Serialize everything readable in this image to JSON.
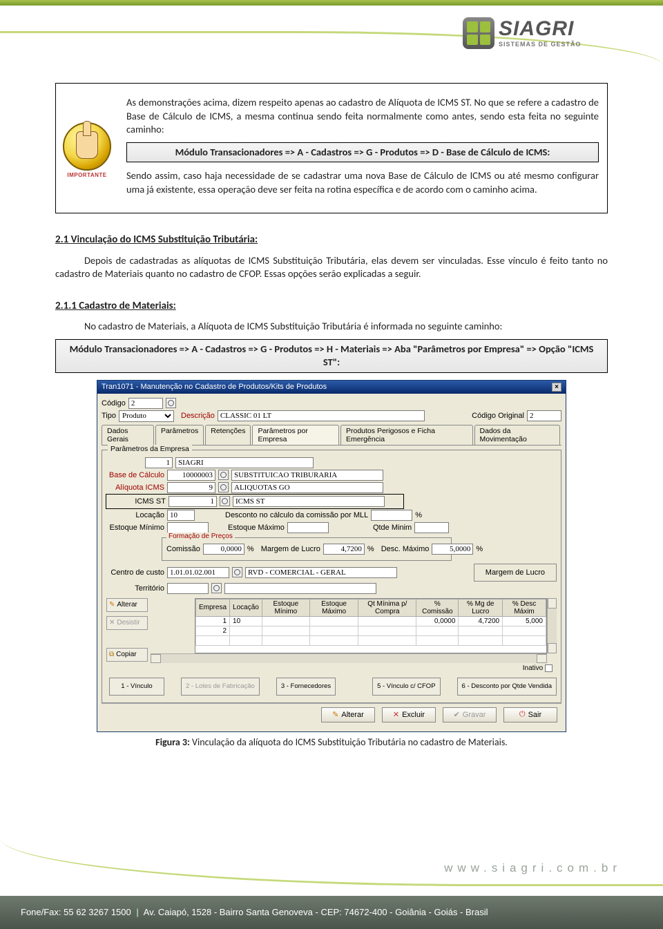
{
  "logo": {
    "name": "SIAGRI",
    "tagline": "SISTEMAS DE GESTÃO"
  },
  "callout": {
    "p1": "As demonstrações acima, dizem respeito apenas ao cadastro de Alíquota de ICMS ST. No que se refere a cadastro de Base de Cálculo de ICMS, a mesma continua sendo feita normalmente como antes, sendo esta feita no seguinte caminho:",
    "path": "Módulo Transacionadores => A - Cadastros => G - Produtos => D - Base de Cálculo de ICMS:",
    "p2": "Sendo assim, caso haja necessidade de se cadastrar uma nova Base de Cálculo de ICMS ou até mesmo configurar uma já existente, essa operação deve ser feita na rotina específica e de acordo com o caminho acima.",
    "badge": "IMPORTANTE"
  },
  "sec21": {
    "title": "2.1  Vinculação do ICMS Substituição Tributária:",
    "p": "Depois de cadastradas as alíquotas de ICMS Substituição Tributária, elas devem ser vinculadas. Esse vínculo é feito tanto no cadastro de Materiais quanto no cadastro de CFOP. Essas opções serão explicadas a seguir."
  },
  "sec211": {
    "title": "2.1.1  Cadastro de Materiais:",
    "p": "No cadastro de Materiais, a Alíquota de ICMS Substituição Tributária é informada no seguinte caminho:",
    "path": "Módulo Transacionadores => A - Cadastros => G - Produtos => H - Materiais => Aba \"Parâmetros por Empresa\" => Opção \"ICMS ST\":"
  },
  "scr": {
    "title": "Tran1071 - Manutenção no Cadastro de Produtos/Kits de Produtos",
    "labels": {
      "codigo": "Código",
      "tipo": "Tipo",
      "descricao": "Descrição",
      "codigo_original": "Código Original",
      "tabs": [
        "Dados Gerais",
        "Parâmetros",
        "Retenções",
        "Parâmetros por Empresa",
        "Produtos Perigosos e Ficha Emergência",
        "Dados da Movimentação"
      ],
      "fieldset": "Parâmetros da Empresa",
      "base_calc": "Base de Cálculo",
      "aliq_icms": "Alíquota ICMS",
      "icms_st": "ICMS ST",
      "locacao": "Locação",
      "desc_comissao": "Desconto no cálculo da comissão por MLL",
      "perc": "%",
      "est_min": "Estoque Mínimo",
      "est_max": "Estoque Máximo",
      "qtde_min": "Qtde Minim",
      "form_precos": "Formação de Preços",
      "comissao": "Comissão",
      "margem_lucro": "Margem de Lucro",
      "desc_max": "Desc. Máximo",
      "centro_custo": "Centro de custo",
      "territorio": "Território",
      "margem_lucro2": "Margem de Lucro",
      "side_alterar": "Alterar",
      "side_desistir": "Desistir",
      "side_copiar": "Copiar",
      "cols": [
        "Empresa",
        "Locação",
        "Estoque Mínimo",
        "Estoque Máximo",
        "Qt Mínima p/ Compra",
        "% Comissão",
        "% Mg de Lucro",
        "% Desc Máxim"
      ],
      "inativo": "Inativo",
      "bot": [
        "1 - Vínculo",
        "2 - Lotes de Fabricação",
        "3 - Fornecedores",
        "5 - Vínculo c/ CFOP",
        "6 - Desconto por Qtde Vendida"
      ],
      "act_alterar": "Alterar",
      "act_excluir": "Excluir",
      "act_gravar": "Gravar",
      "act_sair": "Sair"
    },
    "values": {
      "codigo": "2",
      "tipo": "Produto",
      "descricao": "CLASSIC 01 LT",
      "codigo_original": "2",
      "empresa_num": "1",
      "empresa_nome": "SIAGRI",
      "base_calc": "10000003",
      "base_calc_desc": "SUBSTITUICAO TRIBURARIA",
      "aliq_icms": "9",
      "aliq_icms_desc": "ALIQUOTAS GO",
      "icms_st": "1",
      "icms_st_desc": "ICMS ST",
      "locacao": "10",
      "comissao": "0,0000",
      "margem": "4,7200",
      "desc_max": "5,0000",
      "cc": "1.01.01.02.001",
      "cc_desc": "RVD - COMERCIAL - GERAL",
      "grid_rows": [
        {
          "empresa": "1",
          "locacao": "10",
          "emin": "",
          "emax": "",
          "qtmin": "",
          "comissao": "0,0000",
          "mg": "4,7200",
          "dmax": "5,000"
        },
        {
          "empresa": "2",
          "locacao": "",
          "emin": "",
          "emax": "",
          "qtmin": "",
          "comissao": "",
          "mg": "",
          "dmax": ""
        }
      ]
    }
  },
  "figure": {
    "label": "Figura 3:",
    "text": " Vinculação da alíquota do ICMS Substituição Tributária no cadastro de Materiais."
  },
  "footer": {
    "url": "www.siagri.com.br",
    "fone_lbl": "Fone/Fax: ",
    "fone": "55 62 3267 1500",
    "addr": "Av. Caiapó, 1528 - Bairro Santa Genoveva - CEP: 74672-400 - Goiânia - Goiás - Brasil"
  }
}
